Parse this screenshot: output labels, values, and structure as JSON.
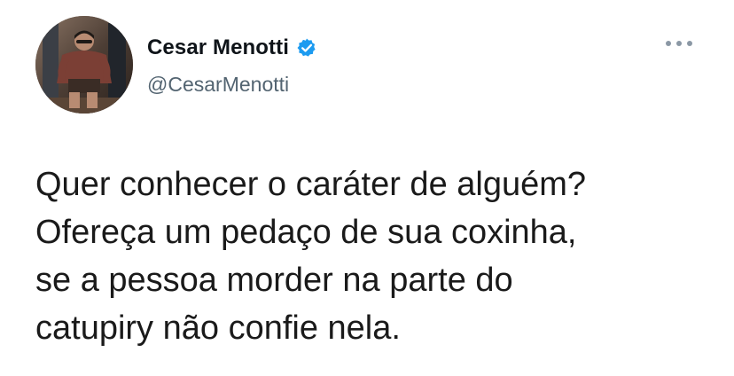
{
  "tweet": {
    "author": {
      "display_name": "Cesar Menotti",
      "handle": "@CesarMenotti",
      "verified": true,
      "avatar_icon": "profile-photo",
      "verified_icon": "verified-badge-icon"
    },
    "menu_icon": "more-options-icon",
    "text_lines": [
      "Quer conhecer o caráter de alguém?",
      "Ofereça um pedaço de sua coxinha,",
      "se a pessoa morder na parte do",
      "catupiry não confie nela."
    ]
  },
  "colors": {
    "verified_blue": "#1d9bf0",
    "handle_gray": "#536471",
    "text_dark": "#0f1419",
    "background": "#ffffff"
  }
}
